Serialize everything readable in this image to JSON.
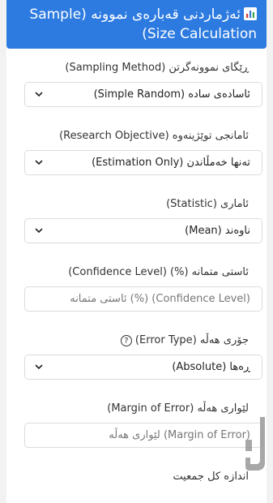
{
  "header": {
    "title": "ئەژماردنی قەبارەی نموونە (Sample Size Calculation)",
    "icon": "bar-chart-icon"
  },
  "fields": [
    {
      "label": "ڕێگای نموونەگرتن (Sampling Method)",
      "value": "ئاسادەی سادە (Simple Random)"
    },
    {
      "label": "ئامانجی توێژینەوە (Research Objective)",
      "value": "تەنها خەمڵاندن (Estimation Only)"
    },
    {
      "label": "ئاماری (Statistic)",
      "value": "ناوەند (Mean)"
    },
    {
      "label": "ئاستی متمانە (%) (Confidence Level)",
      "placeholder": "(Confidence Level) (%) ئاستی متمانە"
    },
    {
      "label": "جۆری هەڵە (Error Type)",
      "value": "ڕەها (Absolute)"
    },
    {
      "label": "لێواری هەڵە (Margin of Error)",
      "placeholder": "(Margin of Error) لێواری هەڵە"
    },
    {
      "label": "اندازه کل جمعیت"
    }
  ],
  "help_icon_glyph": "?",
  "colors": {
    "header": "#2d7be0",
    "watermark": "#8a8a8a"
  }
}
